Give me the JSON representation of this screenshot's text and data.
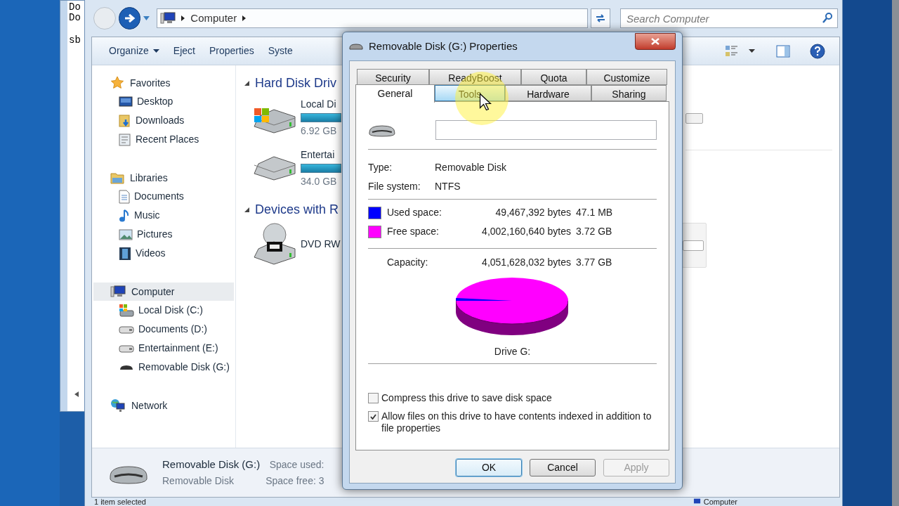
{
  "console": {
    "lines": [
      "Do",
      "Do",
      "sb"
    ]
  },
  "explorer": {
    "address": {
      "segments": [
        "Computer"
      ]
    },
    "search": {
      "placeholder": "Search Computer"
    },
    "toolbar": [
      {
        "label": "Organize",
        "dropdown": true
      },
      {
        "label": "Eject",
        "dropdown": false
      },
      {
        "label": "Properties",
        "dropdown": false
      },
      {
        "label": "Syste",
        "dropdown": false
      }
    ],
    "sidebar": [
      {
        "label": "Favorites",
        "kind": "star",
        "selected": false,
        "children": [
          {
            "label": "Desktop",
            "kind": "desktop",
            "selected": false
          },
          {
            "label": "Downloads",
            "kind": "downloads",
            "selected": false
          },
          {
            "label": "Recent Places",
            "kind": "recent",
            "selected": false
          }
        ]
      },
      {
        "label": "Libraries",
        "kind": "library",
        "selected": false,
        "children": [
          {
            "label": "Documents",
            "kind": "document",
            "selected": false
          },
          {
            "label": "Music",
            "kind": "music",
            "selected": false
          },
          {
            "label": "Pictures",
            "kind": "picture",
            "selected": false
          },
          {
            "label": "Videos",
            "kind": "video",
            "selected": false
          }
        ]
      },
      {
        "label": "Computer",
        "kind": "computer",
        "selected": true,
        "children": [
          {
            "label": "Local Disk (C:)",
            "kind": "windows-drive",
            "selected": false
          },
          {
            "label": "Documents (D:)",
            "kind": "drive",
            "selected": false
          },
          {
            "label": "Entertainment (E:)",
            "kind": "drive",
            "selected": false
          },
          {
            "label": "Removable Disk (G:)",
            "kind": "removable",
            "selected": false
          }
        ]
      },
      {
        "label": "Network",
        "kind": "network",
        "selected": false
      }
    ],
    "groups": [
      {
        "title": "Hard Disk Driv",
        "items": [
          {
            "name": "Local Di",
            "detail": "6.92 GB",
            "kind": "windows-drive"
          },
          {
            "name": "Entertai",
            "detail": "34.0 GB",
            "kind": "drive"
          }
        ]
      },
      {
        "title": "Devices with R",
        "items": [
          {
            "name": "DVD RW",
            "kind": "dvd"
          }
        ]
      }
    ],
    "details": {
      "name": "Removable Disk (G:)",
      "type": "Removable Disk",
      "fields": [
        "Space used:",
        "Space free: 3"
      ]
    },
    "status_bar": {
      "left": "1 item selected",
      "right": "Computer"
    }
  },
  "dialog": {
    "title": "Removable Disk (G:) Properties",
    "tab_rows": [
      [
        {
          "label": "Security",
          "selected": false,
          "hovered": false
        },
        {
          "label": "ReadyBoost",
          "selected": false,
          "hovered": false
        },
        {
          "label": "Quota",
          "selected": false,
          "hovered": false
        },
        {
          "label": "Customize",
          "selected": false,
          "hovered": false
        }
      ],
      [
        {
          "label": "General",
          "selected": true,
          "hovered": false
        },
        {
          "label": "Tools",
          "selected": false,
          "hovered": true
        },
        {
          "label": "Hardware",
          "selected": false,
          "hovered": false
        },
        {
          "label": "Sharing",
          "selected": false,
          "hovered": false
        }
      ]
    ],
    "info": [
      {
        "label": "Type:",
        "value": "Removable Disk"
      },
      {
        "label": "File system:",
        "value": "NTFS"
      }
    ],
    "space": [
      {
        "label": "Used space:",
        "bytes": "49,467,392 bytes",
        "size": "47.1 MB",
        "color": "#0000ff"
      },
      {
        "label": "Free space:",
        "bytes": "4,002,160,640 bytes",
        "size": "3.72 GB",
        "color": "#ff00ff"
      }
    ],
    "capacity": {
      "label": "Capacity:",
      "bytes": "4,051,628,032 bytes",
      "size": "3.77 GB"
    },
    "pie_caption": "Drive G:",
    "options": [
      {
        "label": "Compress this drive to save disk space",
        "checked": false
      },
      {
        "label": "Allow files on this drive to have contents indexed in addition to file properties",
        "checked": true
      }
    ],
    "buttons": [
      {
        "label": "OK",
        "default": true,
        "disabled": false
      },
      {
        "label": "Cancel",
        "default": false,
        "disabled": false
      },
      {
        "label": "Apply",
        "default": false,
        "disabled": true
      }
    ]
  }
}
